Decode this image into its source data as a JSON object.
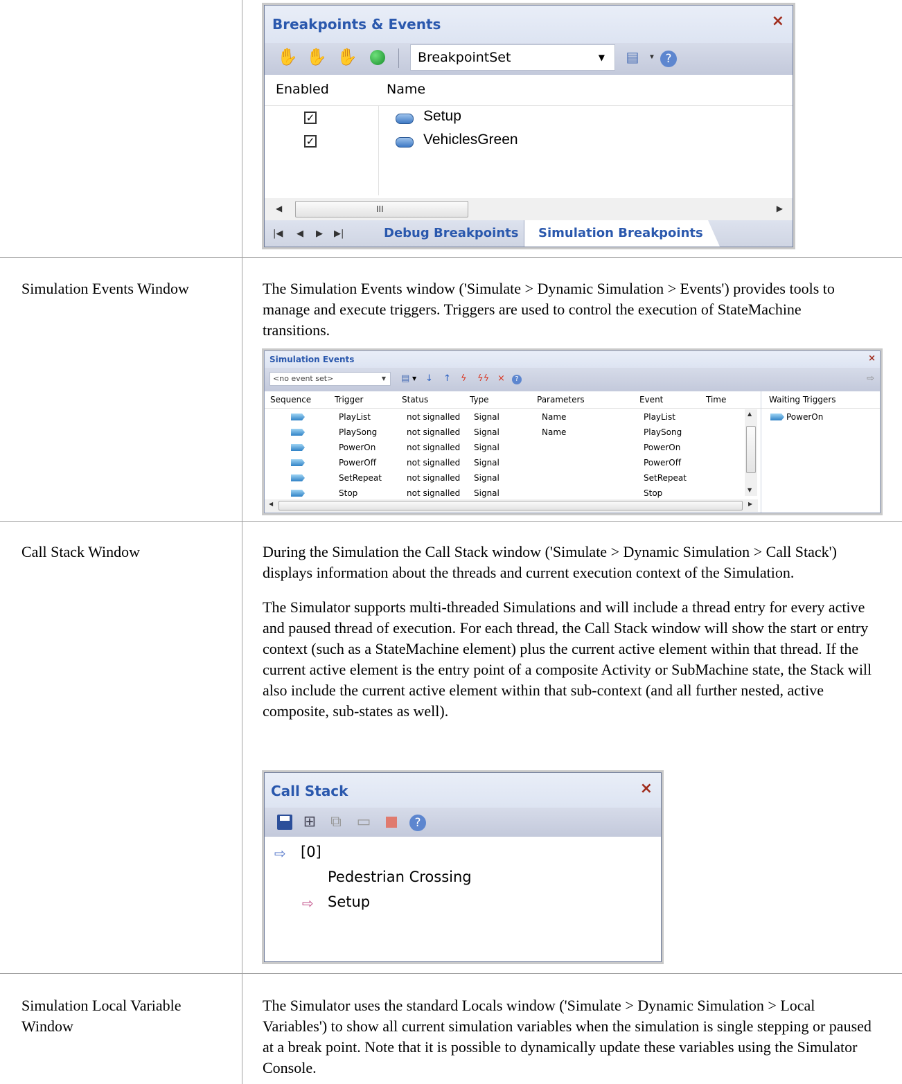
{
  "breakpoints_window": {
    "title": "Breakpoints & Events",
    "close_icon": "×",
    "breakpoint_set": "BreakpointSet",
    "columns": [
      "Enabled",
      "Name"
    ],
    "rows": [
      {
        "enabled": "✓",
        "name": "Setup"
      },
      {
        "enabled": "✓",
        "name": "VehiclesGreen"
      }
    ],
    "scroll_glyph": "III",
    "tabs": [
      "Debug Breakpoints",
      "Simulation Breakpoints"
    ],
    "active_tab": "Simulation Breakpoints"
  },
  "sections": [
    {
      "label": "Simulation Events Window",
      "paragraphs": [
        "The Simulation Events window ('Simulate > Dynamic Simulation > Events') provides tools to manage and execute triggers. Triggers are used to control the execution of StateMachine transitions."
      ]
    },
    {
      "label": "Call Stack Window",
      "paragraphs": [
        "During the Simulation the Call Stack window ('Simulate > Dynamic Simulation > Call Stack') displays information about the threads and current execution context of the Simulation.",
        "The Simulator supports multi-threaded Simulations and will include a thread entry for every active and paused thread of execution. For each thread, the Call Stack window will show the start or entry context (such as a StateMachine element) plus the current active element within that thread. If the current active element is the entry point of a composite Activity or SubMachine state, the Stack will also include the current active element within that sub-context (and all further nested, active composite, sub-states as well)."
      ]
    },
    {
      "label": "Simulation Local Variable Window",
      "paragraphs": [
        "The Simulator uses the standard Locals window ('Simulate > Dynamic Simulation > Local Variables') to show all current simulation variables when the simulation is single stepping or paused at a break point. Note that it is possible to dynamically update these variables using the Simulator Console."
      ]
    }
  ],
  "simulation_events_window": {
    "title": "Simulation Events",
    "close_icon": "×",
    "event_set": "<no event set>",
    "columns": [
      "Sequence",
      "Trigger",
      "Status",
      "Type",
      "Parameters",
      "Event",
      "Time"
    ],
    "waiting_header": "Waiting Triggers",
    "waiting_items": [
      "PowerOn"
    ],
    "rows": [
      {
        "trigger": "PlayList",
        "status": "not signalled",
        "type": "Signal",
        "parameters": "Name",
        "event": "PlayList"
      },
      {
        "trigger": "PlaySong",
        "status": "not signalled",
        "type": "Signal",
        "parameters": "Name",
        "event": "PlaySong"
      },
      {
        "trigger": "PowerOn",
        "status": "not signalled",
        "type": "Signal",
        "parameters": "",
        "event": "PowerOn"
      },
      {
        "trigger": "PowerOff",
        "status": "not signalled",
        "type": "Signal",
        "parameters": "",
        "event": "PowerOff"
      },
      {
        "trigger": "SetRepeat",
        "status": "not signalled",
        "type": "Signal",
        "parameters": "",
        "event": "SetRepeat"
      },
      {
        "trigger": "Stop",
        "status": "not signalled",
        "type": "Signal",
        "parameters": "",
        "event": "Stop"
      }
    ]
  },
  "call_stack_window": {
    "title": "Call Stack",
    "close_icon": "×",
    "thread": "[0]",
    "context": "Pedestrian Crossing",
    "current": "Setup"
  }
}
